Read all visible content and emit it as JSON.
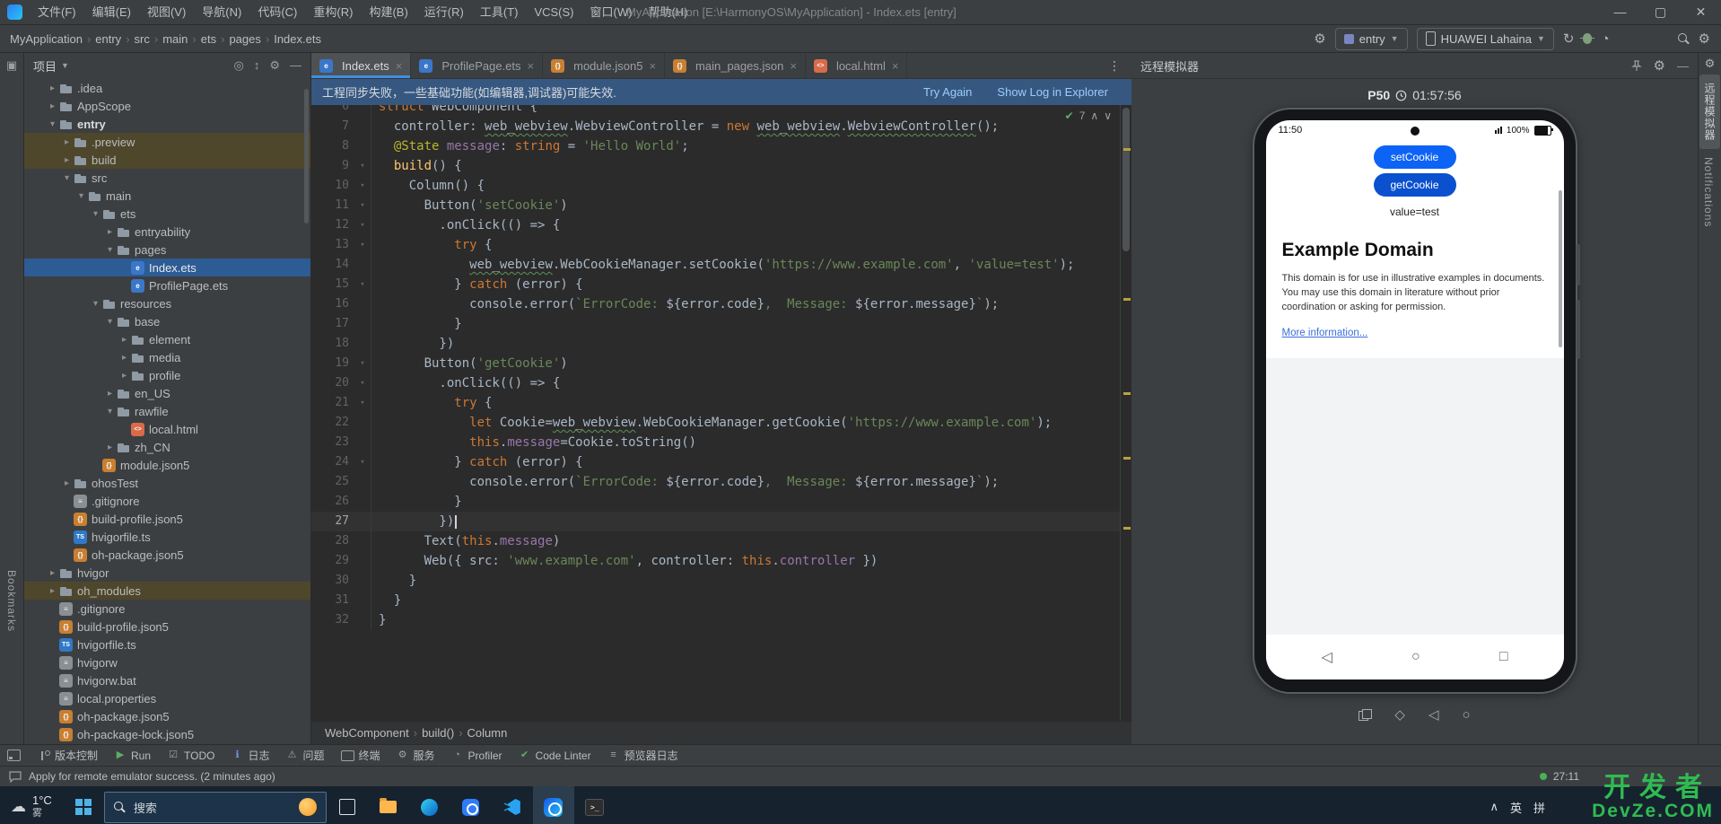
{
  "title_bar": {
    "menus": [
      "文件(F)",
      "编辑(E)",
      "视图(V)",
      "导航(N)",
      "代码(C)",
      "重构(R)",
      "构建(B)",
      "运行(R)",
      "工具(T)",
      "VCS(S)",
      "窗口(W)",
      "帮助(H)"
    ],
    "window_title": "MyApplication [E:\\HarmonyOS\\MyApplication] - Index.ets [entry]"
  },
  "nav_bar": {
    "breadcrumbs": [
      "MyApplication",
      "entry",
      "src",
      "main",
      "ets",
      "pages",
      "Index.ets"
    ],
    "module_select": "entry",
    "device_select": "HUAWEI Lahaina"
  },
  "project": {
    "title": "项目",
    "tree": [
      {
        "label": ".idea",
        "indent": 1,
        "chev": "▸",
        "icon": "folder"
      },
      {
        "label": "AppScope",
        "indent": 1,
        "chev": "▸",
        "icon": "folder"
      },
      {
        "label": "entry",
        "indent": 1,
        "chev": "▾",
        "icon": "module",
        "bold": true
      },
      {
        "label": ".preview",
        "indent": 2,
        "chev": "▸",
        "icon": "folder",
        "bg": "excluded"
      },
      {
        "label": "build",
        "indent": 2,
        "chev": "▸",
        "icon": "folder",
        "bg": "excluded"
      },
      {
        "label": "src",
        "indent": 2,
        "chev": "▾",
        "icon": "folder"
      },
      {
        "label": "main",
        "indent": 3,
        "chev": "▾",
        "icon": "folder"
      },
      {
        "label": "ets",
        "indent": 4,
        "chev": "▾",
        "icon": "folder"
      },
      {
        "label": "entryability",
        "indent": 5,
        "chev": "▸",
        "icon": "folder"
      },
      {
        "label": "pages",
        "indent": 5,
        "chev": "▾",
        "icon": "folder"
      },
      {
        "label": "Index.ets",
        "indent": 6,
        "icon": "ets",
        "selected": true
      },
      {
        "label": "ProfilePage.ets",
        "indent": 6,
        "icon": "ets"
      },
      {
        "label": "resources",
        "indent": 4,
        "chev": "▾",
        "icon": "folder"
      },
      {
        "label": "base",
        "indent": 5,
        "chev": "▾",
        "icon": "folder"
      },
      {
        "label": "element",
        "indent": 6,
        "chev": "▸",
        "icon": "folder"
      },
      {
        "label": "media",
        "indent": 6,
        "chev": "▸",
        "icon": "folder"
      },
      {
        "label": "profile",
        "indent": 6,
        "chev": "▸",
        "icon": "folder"
      },
      {
        "label": "en_US",
        "indent": 5,
        "chev": "▸",
        "icon": "folder"
      },
      {
        "label": "rawfile",
        "indent": 5,
        "chev": "▾",
        "icon": "folder"
      },
      {
        "label": "local.html",
        "indent": 6,
        "icon": "html"
      },
      {
        "label": "zh_CN",
        "indent": 5,
        "chev": "▸",
        "icon": "folder"
      },
      {
        "label": "module.json5",
        "indent": 4,
        "icon": "json"
      },
      {
        "label": "ohosTest",
        "indent": 2,
        "chev": "▸",
        "icon": "folder"
      },
      {
        "label": ".gitignore",
        "indent": 2,
        "icon": "txt"
      },
      {
        "label": "build-profile.json5",
        "indent": 2,
        "icon": "json"
      },
      {
        "label": "hvigorfile.ts",
        "indent": 2,
        "icon": "ts"
      },
      {
        "label": "oh-package.json5",
        "indent": 2,
        "icon": "json"
      },
      {
        "label": "hvigor",
        "indent": 1,
        "chev": "▸",
        "icon": "folder"
      },
      {
        "label": "oh_modules",
        "indent": 1,
        "chev": "▸",
        "icon": "folder",
        "bg": "excluded"
      },
      {
        "label": ".gitignore",
        "indent": 1,
        "icon": "txt"
      },
      {
        "label": "build-profile.json5",
        "indent": 1,
        "icon": "json"
      },
      {
        "label": "hvigorfile.ts",
        "indent": 1,
        "icon": "ts"
      },
      {
        "label": "hvigorw",
        "indent": 1,
        "icon": "txt"
      },
      {
        "label": "hvigorw.bat",
        "indent": 1,
        "icon": "txt"
      },
      {
        "label": "local.properties",
        "indent": 1,
        "icon": "txt"
      },
      {
        "label": "oh-package.json5",
        "indent": 1,
        "icon": "json"
      },
      {
        "label": "oh-package-lock.json5",
        "indent": 1,
        "icon": "json"
      }
    ]
  },
  "editor": {
    "tabs": [
      {
        "label": "Index.ets",
        "icon": "ets",
        "active": true
      },
      {
        "label": "ProfilePage.ets",
        "icon": "ets"
      },
      {
        "label": "module.json5",
        "icon": "json"
      },
      {
        "label": "main_pages.json",
        "icon": "json"
      },
      {
        "label": "local.html",
        "icon": "html"
      }
    ],
    "banner": {
      "text": "工程同步失败，一些基础功能(如编辑器,调试器)可能失效.",
      "actions": [
        "Try Again",
        "Show Log in Explorer"
      ]
    },
    "inspection_count": "7",
    "breadcrumbs": [
      "WebComponent",
      "build()",
      "Column"
    ],
    "lines": [
      {
        "n": 6,
        "partial": true,
        "segs": [
          [
            "k",
            "struct"
          ],
          [
            "p",
            " WebComponent {"
          ]
        ]
      },
      {
        "n": 7,
        "segs": [
          [
            "p",
            "  controller: "
          ],
          [
            "u",
            "web_webview"
          ],
          [
            "p",
            ".WebviewController = "
          ],
          [
            "k",
            "new"
          ],
          [
            "p",
            " "
          ],
          [
            "u",
            "web_webview"
          ],
          [
            "p",
            "."
          ],
          [
            "u",
            "WebviewController"
          ],
          [
            "p",
            "();"
          ]
        ]
      },
      {
        "n": 8,
        "segs": [
          [
            "p",
            "  "
          ],
          [
            "d",
            "@State"
          ],
          [
            "p",
            " "
          ],
          [
            "f",
            "message"
          ],
          [
            "p",
            ": "
          ],
          [
            "k",
            "string"
          ],
          [
            "p",
            " = "
          ],
          [
            "s",
            "'Hello World'"
          ],
          [
            "p",
            ";"
          ]
        ]
      },
      {
        "n": 9,
        "fold": true,
        "segs": [
          [
            "p",
            "  "
          ],
          [
            "fn",
            "build"
          ],
          [
            "p",
            "() {"
          ]
        ]
      },
      {
        "n": 10,
        "fold": true,
        "segs": [
          [
            "p",
            "    Column() {"
          ]
        ]
      },
      {
        "n": 11,
        "fold": true,
        "segs": [
          [
            "p",
            "      Button("
          ],
          [
            "s",
            "'setCookie'"
          ],
          [
            "p",
            ")"
          ]
        ]
      },
      {
        "n": 12,
        "fold": true,
        "segs": [
          [
            "p",
            "        .onClick(() => {"
          ]
        ]
      },
      {
        "n": 13,
        "fold": true,
        "segs": [
          [
            "p",
            "          "
          ],
          [
            "k",
            "try"
          ],
          [
            "p",
            " {"
          ]
        ]
      },
      {
        "n": 14,
        "segs": [
          [
            "p",
            "            "
          ],
          [
            "u",
            "web_webview"
          ],
          [
            "p",
            ".WebCookieManager.setCookie("
          ],
          [
            "s",
            "'https://www.example.com'"
          ],
          [
            "p",
            ", "
          ],
          [
            "s",
            "'value=test'"
          ],
          [
            "p",
            ");"
          ]
        ]
      },
      {
        "n": 15,
        "fold": true,
        "segs": [
          [
            "p",
            "          } "
          ],
          [
            "k",
            "catch"
          ],
          [
            "p",
            " (error) {"
          ]
        ]
      },
      {
        "n": 16,
        "segs": [
          [
            "p",
            "            console.error("
          ],
          [
            "s",
            "`ErrorCode: "
          ],
          [
            "v",
            "${error.code}"
          ],
          [
            "s",
            ",  Message: "
          ],
          [
            "v",
            "${error.message}"
          ],
          [
            "s",
            "`"
          ],
          [
            "p",
            ");"
          ]
        ]
      },
      {
        "n": 17,
        "segs": [
          [
            "p",
            "          }"
          ]
        ]
      },
      {
        "n": 18,
        "segs": [
          [
            "p",
            "        })"
          ]
        ]
      },
      {
        "n": 19,
        "fold": true,
        "segs": [
          [
            "p",
            "      Button("
          ],
          [
            "s",
            "'getCookie'"
          ],
          [
            "p",
            ")"
          ]
        ]
      },
      {
        "n": 20,
        "fold": true,
        "segs": [
          [
            "p",
            "        .onClick(() => {"
          ]
        ]
      },
      {
        "n": 21,
        "fold": true,
        "segs": [
          [
            "p",
            "          "
          ],
          [
            "k",
            "try"
          ],
          [
            "p",
            " {"
          ]
        ]
      },
      {
        "n": 22,
        "segs": [
          [
            "p",
            "            "
          ],
          [
            "k",
            "let"
          ],
          [
            "p",
            " Cookie="
          ],
          [
            "u",
            "web_webview"
          ],
          [
            "p",
            ".WebCookieManager.getCookie("
          ],
          [
            "s",
            "'https://www.example.com'"
          ],
          [
            "p",
            ");"
          ]
        ]
      },
      {
        "n": 23,
        "segs": [
          [
            "p",
            "            "
          ],
          [
            "k",
            "this"
          ],
          [
            "p",
            "."
          ],
          [
            "f",
            "message"
          ],
          [
            "p",
            "=Cookie.toString()"
          ]
        ]
      },
      {
        "n": 24,
        "fold": true,
        "segs": [
          [
            "p",
            "          } "
          ],
          [
            "k",
            "catch"
          ],
          [
            "p",
            " (error) {"
          ]
        ]
      },
      {
        "n": 25,
        "segs": [
          [
            "p",
            "            console.error("
          ],
          [
            "s",
            "`ErrorCode: "
          ],
          [
            "v",
            "${error.code}"
          ],
          [
            "s",
            ",  Message: "
          ],
          [
            "v",
            "${error.message}"
          ],
          [
            "s",
            "`"
          ],
          [
            "p",
            ");"
          ]
        ]
      },
      {
        "n": 26,
        "segs": [
          [
            "p",
            "          }"
          ]
        ]
      },
      {
        "n": 27,
        "cur": true,
        "segs": [
          [
            "p",
            "        })"
          ]
        ]
      },
      {
        "n": 28,
        "segs": [
          [
            "p",
            "      Text("
          ],
          [
            "k",
            "this"
          ],
          [
            "p",
            "."
          ],
          [
            "f",
            "message"
          ],
          [
            "p",
            ")"
          ]
        ]
      },
      {
        "n": 29,
        "segs": [
          [
            "p",
            "      Web({ src: "
          ],
          [
            "s",
            "'www.example.com'"
          ],
          [
            "p",
            ", controller: "
          ],
          [
            "k",
            "this"
          ],
          [
            "p",
            "."
          ],
          [
            "f",
            "controller"
          ],
          [
            "p",
            " })"
          ]
        ]
      },
      {
        "n": 30,
        "segs": [
          [
            "p",
            "    }"
          ]
        ]
      },
      {
        "n": 31,
        "segs": [
          [
            "p",
            "  }"
          ]
        ]
      },
      {
        "n": 32,
        "segs": [
          [
            "p",
            "}"
          ]
        ]
      }
    ]
  },
  "emulator": {
    "title": "远程模拟器",
    "device_name": "P50",
    "timer": "01:57:56",
    "phone": {
      "status_time": "11:50",
      "battery": "100%",
      "btn_set": "setCookie",
      "btn_get": "getCookie",
      "cookie_value": "value=test",
      "page_heading": "Example Domain",
      "page_body": "This domain is for use in illustrative examples in documents. You may use this domain in literature without prior coordination or asking for permission.",
      "page_link": "More information..."
    }
  },
  "tool_bar": {
    "items": [
      {
        "icon": "branch",
        "label": "版本控制"
      },
      {
        "icon": "run",
        "label": "Run"
      },
      {
        "icon": "todo",
        "label": "TODO"
      },
      {
        "icon": "info",
        "label": "日志"
      },
      {
        "icon": "problems",
        "label": "问题"
      },
      {
        "icon": "terminal",
        "label": "终端"
      },
      {
        "icon": "services",
        "label": "服务"
      },
      {
        "icon": "profiler",
        "label": "Profiler"
      },
      {
        "icon": "lint",
        "label": "Code Linter"
      },
      {
        "icon": "log",
        "label": "预览器日志"
      }
    ]
  },
  "strips": {
    "left": [
      "Bookmarks"
    ],
    "right": [
      "远程模拟器",
      "Notifications"
    ]
  },
  "status_bar": {
    "message": "Apply for remote emulator success. (2 minutes ago)",
    "cursor_position": "27:11"
  },
  "watermark": {
    "line1": "开发者",
    "line2": "DevZe.COM"
  },
  "taskbar": {
    "search_placeholder": "搜索",
    "weather_temp": "1°C",
    "weather_cond": "雾",
    "ime": [
      "英",
      "拼"
    ],
    "apps": [
      {
        "name": "task-view"
      },
      {
        "name": "file-explorer"
      },
      {
        "name": "edge"
      },
      {
        "name": "appgallery"
      },
      {
        "name": "vscode"
      },
      {
        "name": "deveco-studio",
        "active": true
      },
      {
        "name": "terminal"
      }
    ]
  }
}
